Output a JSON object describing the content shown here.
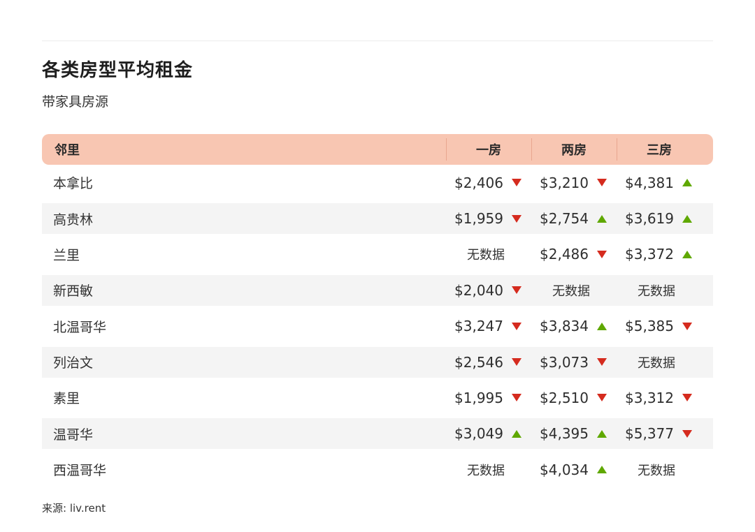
{
  "title": "各类房型平均租金",
  "subtitle": "带家具房源",
  "source": "来源: liv.rent",
  "colors": {
    "header_bg": "#f8c6b2",
    "down": "#d52b1e",
    "up": "#5fa800",
    "row_alt": "#f4f4f4"
  },
  "chart_data": {
    "type": "table",
    "columns": [
      "邻里",
      "一房",
      "两房",
      "三房"
    ],
    "no_data_label": "无数据",
    "rows": [
      {
        "name": "本拿比",
        "cells": [
          {
            "value": "$2,406",
            "trend": "down"
          },
          {
            "value": "$3,210",
            "trend": "down"
          },
          {
            "value": "$4,381",
            "trend": "up"
          }
        ]
      },
      {
        "name": "高贵林",
        "cells": [
          {
            "value": "$1,959",
            "trend": "down"
          },
          {
            "value": "$2,754",
            "trend": "up"
          },
          {
            "value": "$3,619",
            "trend": "up"
          }
        ]
      },
      {
        "name": "兰里",
        "cells": [
          {
            "value": null,
            "trend": null
          },
          {
            "value": "$2,486",
            "trend": "down"
          },
          {
            "value": "$3,372",
            "trend": "up"
          }
        ]
      },
      {
        "name": "新西敏",
        "cells": [
          {
            "value": "$2,040",
            "trend": "down"
          },
          {
            "value": null,
            "trend": null
          },
          {
            "value": null,
            "trend": null
          }
        ]
      },
      {
        "name": "北温哥华",
        "cells": [
          {
            "value": "$3,247",
            "trend": "down"
          },
          {
            "value": "$3,834",
            "trend": "up"
          },
          {
            "value": "$5,385",
            "trend": "down"
          }
        ]
      },
      {
        "name": "列治文",
        "cells": [
          {
            "value": "$2,546",
            "trend": "down"
          },
          {
            "value": "$3,073",
            "trend": "down"
          },
          {
            "value": null,
            "trend": null
          }
        ]
      },
      {
        "name": "素里",
        "cells": [
          {
            "value": "$1,995",
            "trend": "down"
          },
          {
            "value": "$2,510",
            "trend": "down"
          },
          {
            "value": "$3,312",
            "trend": "down"
          }
        ]
      },
      {
        "name": "温哥华",
        "cells": [
          {
            "value": "$3,049",
            "trend": "up"
          },
          {
            "value": "$4,395",
            "trend": "up"
          },
          {
            "value": "$5,377",
            "trend": "down"
          }
        ]
      },
      {
        "name": "西温哥华",
        "cells": [
          {
            "value": null,
            "trend": null
          },
          {
            "value": "$4,034",
            "trend": "up"
          },
          {
            "value": null,
            "trend": null
          }
        ]
      }
    ]
  }
}
